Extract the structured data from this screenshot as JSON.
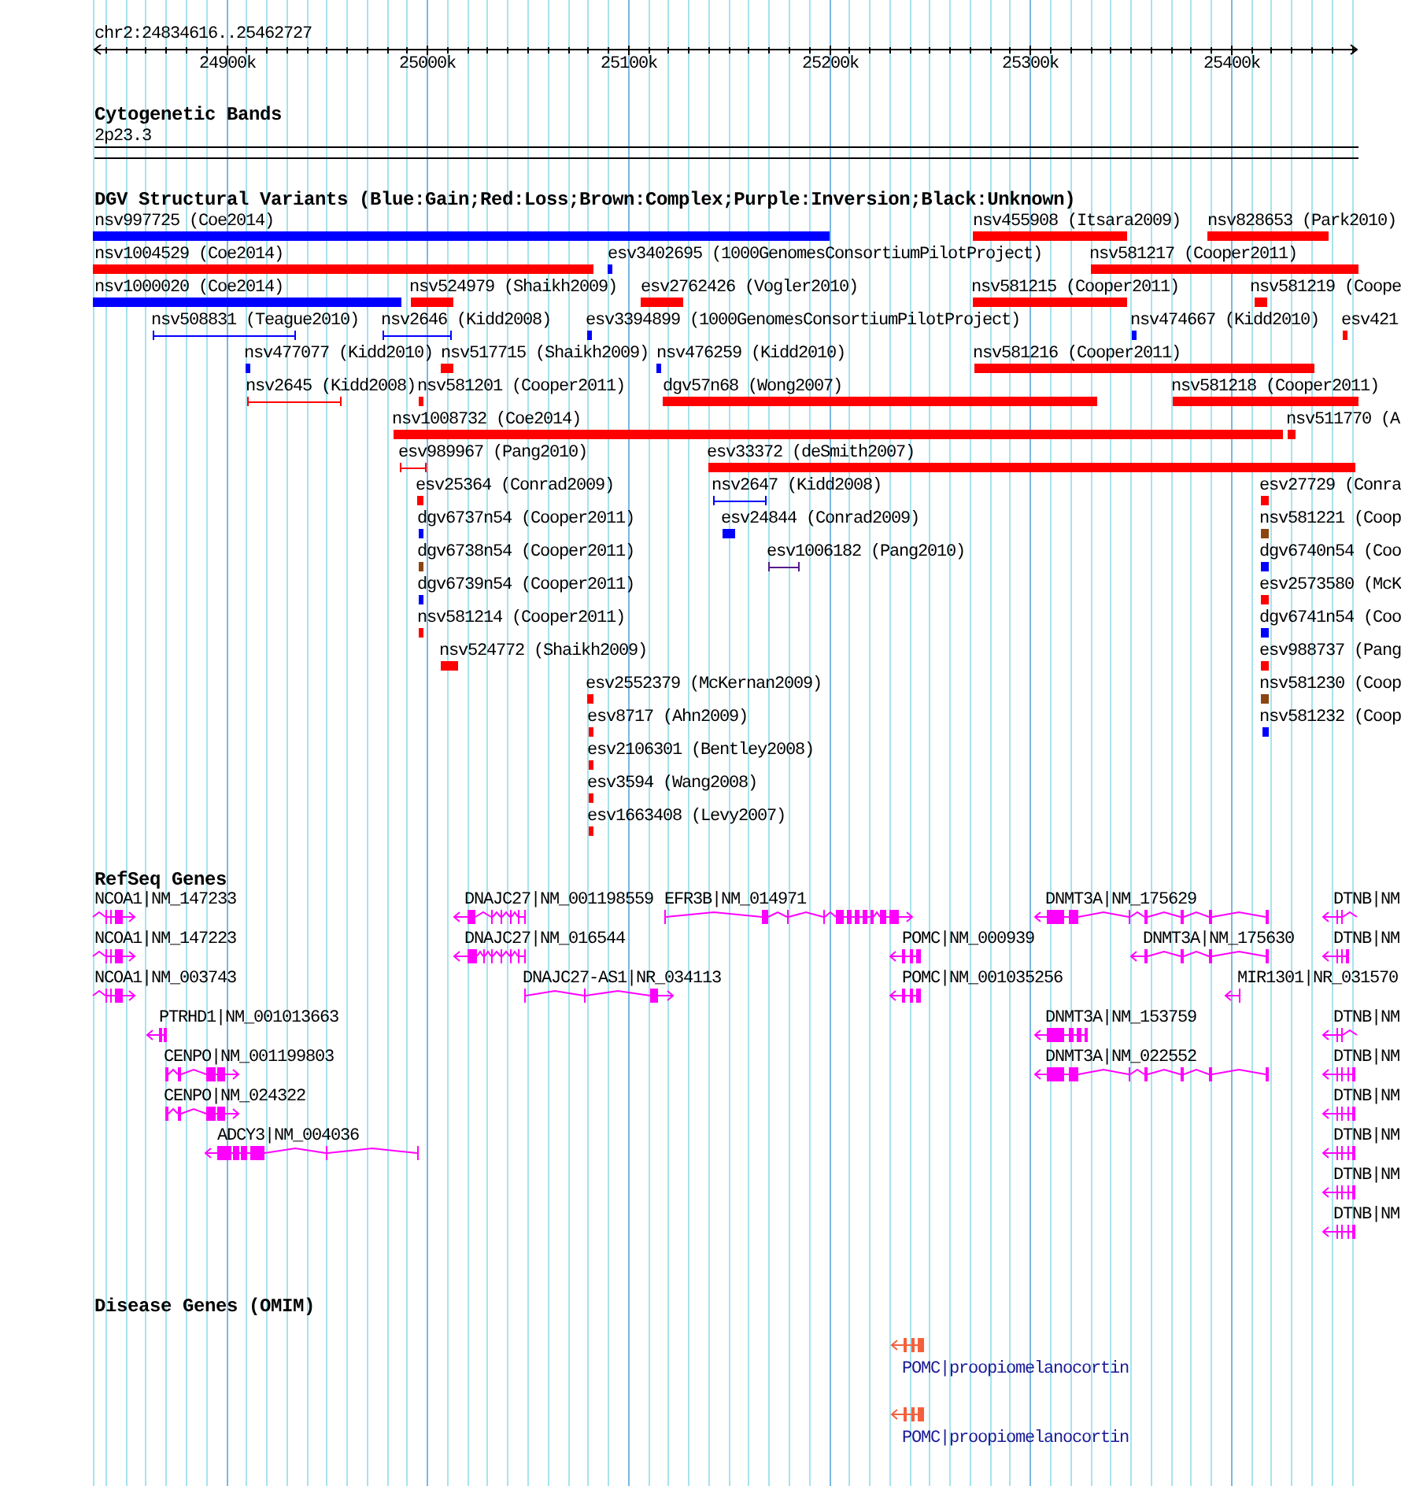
{
  "ruler": {
    "region": "chr2:24834616..25462727",
    "ticks": [
      "24900k",
      "25000k",
      "25100k",
      "25200k",
      "25300k",
      "25400k"
    ]
  },
  "cytogenetic_bands": {
    "title": "Cytogenetic Bands",
    "bands": [
      {
        "label": "2p23.3"
      }
    ]
  },
  "dgv_variants": {
    "title": "DGV Structural Variants (Blue:Gain;Red:Loss;Brown:Complex;Purple:Inversion;Black:Unknown)",
    "features": [
      {
        "label": "nsv997725 (Coe2014)",
        "kind": "bar",
        "color": "#0000ff"
      },
      {
        "label": "nsv455908 (Itsara2009)",
        "kind": "bar",
        "color": "#ff0000"
      },
      {
        "label": "nsv828653 (Park2010)",
        "kind": "bar",
        "color": "#ff0000"
      },
      {
        "label": "nsv1004529 (Coe2014)",
        "kind": "bar",
        "color": "#ff0000"
      },
      {
        "label": "esv3402695 (1000GenomesConsortiumPilotProject)",
        "kind": "bar",
        "color": "#0000ff"
      },
      {
        "label": "nsv581217 (Cooper2011)",
        "kind": "bar",
        "color": "#ff0000"
      },
      {
        "label": "nsv1000020 (Coe2014)",
        "kind": "bar",
        "color": "#0000ff"
      },
      {
        "label": "nsv524979 (Shaikh2009)",
        "kind": "bar",
        "color": "#ff0000"
      },
      {
        "label": "esv2762426 (Vogler2010)",
        "kind": "bar",
        "color": "#ff0000"
      },
      {
        "label": "nsv581215 (Cooper2011)",
        "kind": "bar",
        "color": "#ff0000"
      },
      {
        "label": "nsv581219 (Coope",
        "kind": "bar",
        "color": "#ff0000"
      },
      {
        "label": "nsv508831 (Teague2010)",
        "kind": "span",
        "color": "#0000ff"
      },
      {
        "label": "nsv2646 (Kidd2008)",
        "kind": "span",
        "color": "#0000ff"
      },
      {
        "label": "esv3394899 (1000GenomesConsortiumPilotProject)",
        "kind": "bar",
        "color": "#0000ff"
      },
      {
        "label": "nsv474667 (Kidd2010)",
        "kind": "bar",
        "color": "#0000ff"
      },
      {
        "label": "esv421",
        "kind": "bar",
        "color": "#ff0000"
      },
      {
        "label": "nsv477077 (Kidd2010)",
        "kind": "bar",
        "color": "#0000ff"
      },
      {
        "label": "nsv517715 (Shaikh2009)",
        "kind": "bar",
        "color": "#ff0000"
      },
      {
        "label": "nsv476259 (Kidd2010)",
        "kind": "bar",
        "color": "#0000ff"
      },
      {
        "label": "nsv581216 (Cooper2011)",
        "kind": "bar",
        "color": "#ff0000"
      },
      {
        "label": "nsv2645 (Kidd2008)",
        "kind": "span",
        "color": "#ff0000"
      },
      {
        "label": "nsv581201 (Cooper2011)",
        "kind": "bar",
        "color": "#ff0000"
      },
      {
        "label": "dgv57n68 (Wong2007)",
        "kind": "bar",
        "color": "#ff0000"
      },
      {
        "label": "nsv581218 (Cooper2011)",
        "kind": "bar",
        "color": "#ff0000"
      },
      {
        "label": "nsv1008732 (Coe2014)",
        "kind": "bar",
        "color": "#ff0000"
      },
      {
        "label": "nsv511770 (A",
        "kind": "bar",
        "color": "#ff0000"
      },
      {
        "label": "esv989967 (Pang2010)",
        "kind": "span",
        "color": "#ff0000"
      },
      {
        "label": "esv33372 (deSmith2007)",
        "kind": "bar",
        "color": "#ff0000"
      },
      {
        "label": "esv25364 (Conrad2009)",
        "kind": "bar",
        "color": "#ff0000"
      },
      {
        "label": "nsv2647 (Kidd2008)",
        "kind": "span",
        "color": "#0000ff"
      },
      {
        "label": "esv27729 (Conra",
        "kind": "bar",
        "color": "#ff0000"
      },
      {
        "label": "dgv6737n54 (Cooper2011)",
        "kind": "bar",
        "color": "#0000ff"
      },
      {
        "label": "esv24844 (Conrad2009)",
        "kind": "bar",
        "color": "#0000ff"
      },
      {
        "label": "nsv581221 (Coop",
        "kind": "bar",
        "color": "#8b4513"
      },
      {
        "label": "dgv6738n54 (Cooper2011)",
        "kind": "bar",
        "color": "#8b4513"
      },
      {
        "label": "esv1006182 (Pang2010)",
        "kind": "span",
        "color": "#551a8b"
      },
      {
        "label": "dgv6740n54 (Coo",
        "kind": "bar",
        "color": "#0000ff"
      },
      {
        "label": "dgv6739n54 (Cooper2011)",
        "kind": "bar",
        "color": "#0000ff"
      },
      {
        "label": "esv2573580 (McK",
        "kind": "bar",
        "color": "#ff0000"
      },
      {
        "label": "nsv581214 (Cooper2011)",
        "kind": "bar",
        "color": "#ff0000"
      },
      {
        "label": "dgv6741n54 (Coo",
        "kind": "bar",
        "color": "#0000ff"
      },
      {
        "label": "nsv524772 (Shaikh2009)",
        "kind": "bar",
        "color": "#ff0000"
      },
      {
        "label": "esv988737 (Pang",
        "kind": "bar",
        "color": "#ff0000"
      },
      {
        "label": "esv2552379 (McKernan2009)",
        "kind": "bar",
        "color": "#ff0000"
      },
      {
        "label": "nsv581230 (Coop",
        "kind": "bar",
        "color": "#8b4513"
      },
      {
        "label": "esv8717 (Ahn2009)",
        "kind": "bar",
        "color": "#ff0000"
      },
      {
        "label": "nsv581232 (Coop",
        "kind": "bar",
        "color": "#0000ff"
      },
      {
        "label": "esv2106301 (Bentley2008)",
        "kind": "bar",
        "color": "#ff0000"
      },
      {
        "label": "esv3594 (Wang2008)",
        "kind": "bar",
        "color": "#ff0000"
      },
      {
        "label": "esv1663408 (Levy2007)",
        "kind": "bar",
        "color": "#ff0000"
      }
    ]
  },
  "refseq_genes": {
    "title": "RefSeq Genes",
    "genes": [
      {
        "label": "NCOA1|NM_147233",
        "forward": true
      },
      {
        "label": "DNAJC27|NM_001198559",
        "forward": false
      },
      {
        "label": "EFR3B|NM_014971",
        "forward": true
      },
      {
        "label": "DNMT3A|NM_175629",
        "forward": false
      },
      {
        "label": "DTNB|NM",
        "forward": false
      },
      {
        "label": "NCOA1|NM_147223",
        "forward": true
      },
      {
        "label": "DNAJC27|NM_016544",
        "forward": false
      },
      {
        "label": "POMC|NM_000939",
        "forward": false
      },
      {
        "label": "DNMT3A|NM_175630",
        "forward": false
      },
      {
        "label": "DTNB|NM",
        "forward": false
      },
      {
        "label": "NCOA1|NM_003743",
        "forward": true
      },
      {
        "label": "DNAJC27-AS1|NR_034113",
        "forward": true
      },
      {
        "label": "POMC|NM_001035256",
        "forward": false
      },
      {
        "label": "MIR1301|NR_031570",
        "forward": false
      },
      {
        "label": "PTRHD1|NM_001013663",
        "forward": false
      },
      {
        "label": "DNMT3A|NM_153759",
        "forward": false
      },
      {
        "label": "DTNB|NM",
        "forward": false
      },
      {
        "label": "CENPO|NM_001199803",
        "forward": true
      },
      {
        "label": "DNMT3A|NM_022552",
        "forward": false
      },
      {
        "label": "DTNB|NM",
        "forward": false
      },
      {
        "label": "CENPO|NM_024322",
        "forward": true
      },
      {
        "label": "DTNB|NM",
        "forward": false
      },
      {
        "label": "ADCY3|NM_004036",
        "forward": false
      },
      {
        "label": "DTNB|NM",
        "forward": false
      },
      {
        "label": "DTNB|NM",
        "forward": false
      },
      {
        "label": "DTNB|NM",
        "forward": false
      }
    ]
  },
  "disease_genes": {
    "title": "Disease Genes (OMIM)",
    "genes": [
      {
        "label": "POMC|proopiomelanocortin",
        "forward": false
      },
      {
        "label": "POMC|proopiomelanocortin",
        "forward": false
      }
    ]
  }
}
